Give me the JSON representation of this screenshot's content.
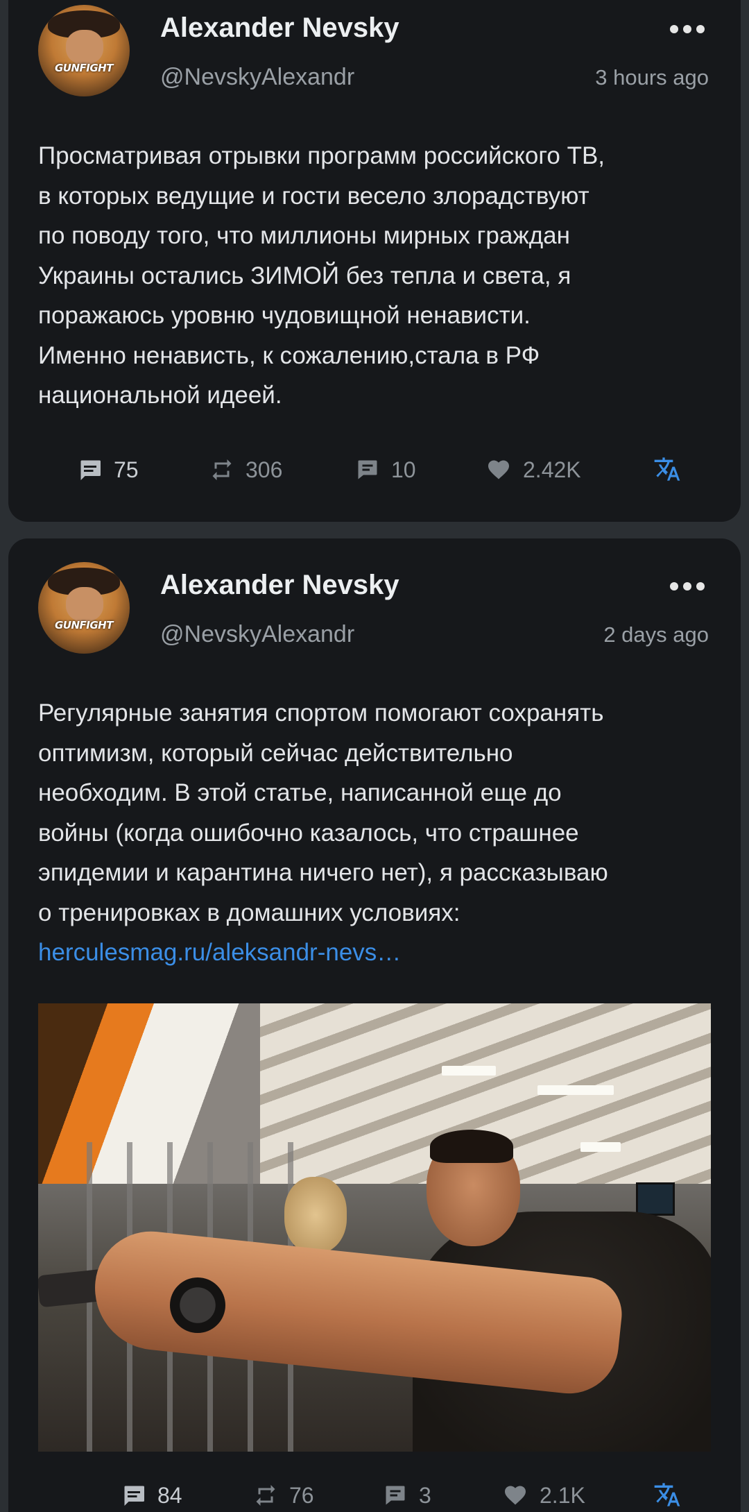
{
  "posts": [
    {
      "author_name": "Alexander Nevsky",
      "handle": "@NevskyAlexandr",
      "timestamp": "3 hours ago",
      "avatar_text": "GUNFIGHT",
      "body_lines": [
        "Просматривая отрывки программ российского ТВ,",
        "в которых ведущие и гости весело злорадствуют",
        "по поводу того, что миллионы мирных граждан",
        "Украины остались ЗИМОЙ без тепла и света, я",
        "поражаюсь уровню чудовищной ненависти.",
        "Именно ненависть, к сожалению,стала в РФ",
        "национальной идеей."
      ],
      "link": "",
      "stats": {
        "replies": "75",
        "retweets": "306",
        "quotes": "10",
        "likes": "2.42K"
      }
    },
    {
      "author_name": "Alexander Nevsky",
      "handle": "@NevskyAlexandr",
      "timestamp": "2 days ago",
      "avatar_text": "GUNFIGHT",
      "body_lines": [
        "Регулярные занятия спортом помогают сохранять",
        "оптимизм, который сейчас действительно",
        "необходим. В этой статье, написанной еще до",
        "войны (когда ошибочно казалось, что страшнее",
        "эпидемии и карантина ничего нет), я рассказываю",
        "о тренировках в домашних условиях:"
      ],
      "link": "herculesmag.ru/aleksandr-nevs…",
      "stats": {
        "replies": "84",
        "retweets": "76",
        "quotes": "3",
        "likes": "2.1K"
      }
    }
  ],
  "icons": {
    "replies": "comment-icon",
    "retweets": "retweet-icon",
    "quotes": "quote-icon",
    "likes": "heart-icon",
    "translate": "translate-icon",
    "more": "more-options-icon"
  },
  "colors": {
    "background": "#2b2f33",
    "card": "#16181b",
    "link": "#3b8ee6",
    "translate": "#3b8ee6",
    "muted": "#8d9399"
  }
}
